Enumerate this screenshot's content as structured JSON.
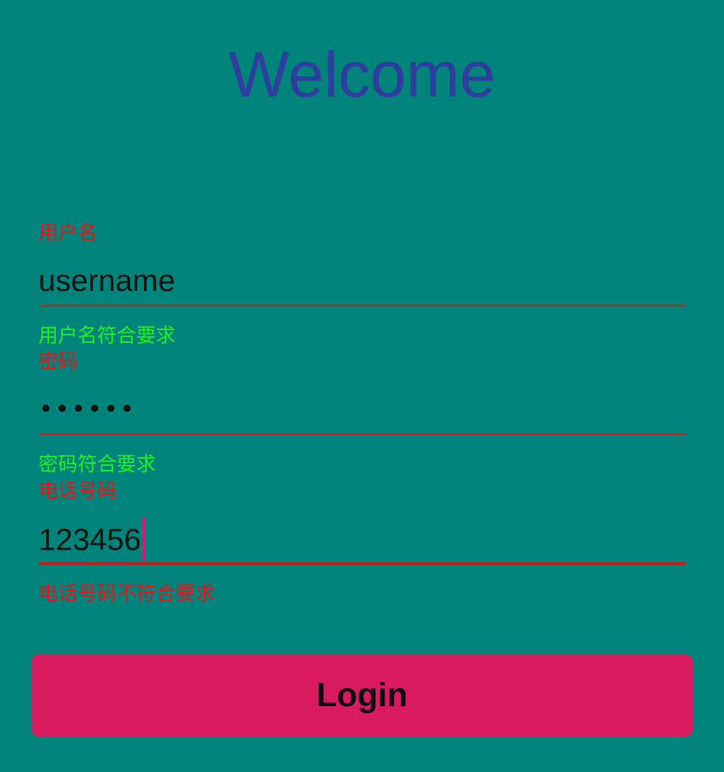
{
  "title": "Welcome",
  "fields": {
    "username": {
      "label": "用户名",
      "value": "username",
      "helper": "用户名符合要求",
      "helper_status": "valid"
    },
    "password": {
      "label": "密码",
      "value": "••••••",
      "helper": "密码符合要求",
      "helper_status": "valid"
    },
    "phone": {
      "label": "电话号码",
      "value": "123456",
      "helper": "电话号码不符合要求",
      "helper_status": "invalid"
    }
  },
  "login_button": {
    "label": "Login"
  },
  "colors": {
    "background": "#00837A",
    "title": "#2E3D9E",
    "label": "#E8141A",
    "helper_ok": "#1BF41E",
    "helper_error": "#E8141A",
    "underline": "#D01A1E",
    "button": "#D81B5E"
  }
}
